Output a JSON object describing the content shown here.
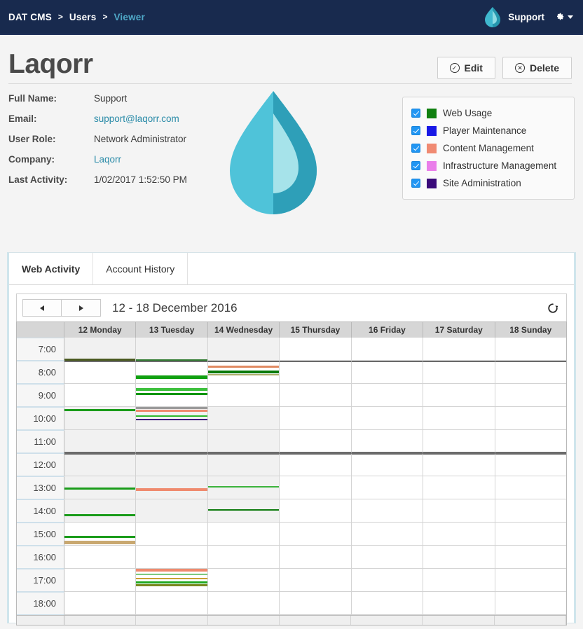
{
  "topnav": {
    "breadcrumb": [
      {
        "label": "DAT CMS",
        "active": false
      },
      {
        "label": "Users",
        "active": false
      },
      {
        "label": "Viewer",
        "active": true
      }
    ],
    "separator": ">",
    "user_label": "Support",
    "gear_icon": "gear-icon",
    "caret_icon": "chevron-down-icon",
    "logo_icon": "droplet-logo-icon",
    "bg_color": "#182a4e",
    "active_crumb_color": "#4fa8c7"
  },
  "profile": {
    "title": "Laqorr",
    "edit_label": "Edit",
    "edit_glyph": "✓",
    "delete_label": "Delete",
    "delete_glyph": "✕",
    "fields": [
      {
        "label": "Full Name:",
        "value": "Support",
        "link": false
      },
      {
        "label": "Email:",
        "value": "support@laqorr.com",
        "link": true
      },
      {
        "label": "User Role:",
        "value": "Network Administrator",
        "link": false
      },
      {
        "label": "Company:",
        "value": "Laqorr",
        "link": true
      },
      {
        "label": "Last Activity:",
        "value": "1/02/2017 1:52:50 PM",
        "link": false
      }
    ]
  },
  "legend": {
    "items": [
      {
        "label": "Web Usage",
        "color": "#108010",
        "checked": true
      },
      {
        "label": "Player Maintenance",
        "color": "#1818e6",
        "checked": true
      },
      {
        "label": "Content Management",
        "color": "#f08a72",
        "checked": true
      },
      {
        "label": "Infrastructure Management",
        "color": "#ea7eea",
        "checked": true
      },
      {
        "label": "Site Administration",
        "color": "#3a0a7a",
        "checked": true
      }
    ]
  },
  "tabs": [
    {
      "label": "Web Activity",
      "active": true
    },
    {
      "label": "Account History",
      "active": false
    }
  ],
  "calendar": {
    "prev_icon": "triangle-left-icon",
    "next_icon": "triangle-right-icon",
    "range_label": "12 - 18 December 2016",
    "refresh_icon": "refresh-icon",
    "gutter_header": "",
    "days": [
      "12 Monday",
      "13 Tuesday",
      "14 Wednesday",
      "15 Thursday",
      "16 Friday",
      "17 Saturday",
      "18 Sunday"
    ],
    "times": [
      "7:00",
      "8:00",
      "9:00",
      "10:00",
      "11:00",
      "12:00",
      "13:00",
      "14:00",
      "15:00",
      "16:00",
      "17:00",
      "18:00"
    ],
    "shaded_rows": [
      0,
      3,
      4,
      5,
      6,
      7
    ],
    "shaded_days": [
      0,
      1,
      2
    ],
    "heavy_line_rows": [
      1,
      5
    ],
    "events": [
      {
        "day": 0,
        "row": 0,
        "offset": 30,
        "color": "#4a5a20",
        "height": 4
      },
      {
        "day": 0,
        "row": 3,
        "offset": 3,
        "color": "#1a9c1a",
        "height": 3
      },
      {
        "day": 0,
        "row": 6,
        "offset": 16,
        "color": "#1a9c1a",
        "height": 3
      },
      {
        "day": 0,
        "row": 7,
        "offset": 21,
        "color": "#1a9c1a",
        "height": 3
      },
      {
        "day": 0,
        "row": 8,
        "offset": 19,
        "color": "#1a9c1a",
        "height": 3
      },
      {
        "day": 0,
        "row": 8,
        "offset": 26,
        "color": "#c9a870",
        "height": 5
      },
      {
        "day": 1,
        "row": 0,
        "offset": 31,
        "color": "#2f7a2f",
        "height": 2
      },
      {
        "day": 1,
        "row": 1,
        "offset": 19,
        "color": "#10a010",
        "height": 5
      },
      {
        "day": 1,
        "row": 2,
        "offset": 6,
        "color": "#3cc03c",
        "height": 4
      },
      {
        "day": 1,
        "row": 2,
        "offset": 13,
        "color": "#0f960f",
        "height": 3
      },
      {
        "day": 1,
        "row": 3,
        "offset": 0,
        "color": "#9a9a9a",
        "height": 3
      },
      {
        "day": 1,
        "row": 3,
        "offset": 4,
        "color": "#ef8a6e",
        "height": 3
      },
      {
        "day": 1,
        "row": 3,
        "offset": 12,
        "color": "#2eb82e",
        "height": 2
      },
      {
        "day": 1,
        "row": 3,
        "offset": 17,
        "color": "#3a0a7a",
        "height": 2
      },
      {
        "day": 1,
        "row": 6,
        "offset": 17,
        "color": "#ef8a6e",
        "height": 4
      },
      {
        "day": 1,
        "row": 10,
        "offset": 0,
        "color": "#ef8a6e",
        "height": 4
      },
      {
        "day": 1,
        "row": 10,
        "offset": 7,
        "color": "#7ec97e",
        "height": 2
      },
      {
        "day": 1,
        "row": 10,
        "offset": 13,
        "color": "#c9a030",
        "height": 2
      },
      {
        "day": 1,
        "row": 10,
        "offset": 18,
        "color": "#1fa81f",
        "height": 3
      },
      {
        "day": 1,
        "row": 10,
        "offset": 22,
        "color": "#7a8a20",
        "height": 3
      },
      {
        "day": 2,
        "row": 1,
        "offset": 5,
        "color": "#e08a62",
        "height": 3
      },
      {
        "day": 2,
        "row": 1,
        "offset": 12,
        "color": "#0a7a0a",
        "height": 4
      },
      {
        "day": 2,
        "row": 1,
        "offset": 17,
        "color": "#b0b070",
        "height": 2
      },
      {
        "day": 2,
        "row": 6,
        "offset": 14,
        "color": "#3cb33c",
        "height": 2
      },
      {
        "day": 2,
        "row": 7,
        "offset": 14,
        "color": "#0d7a0d",
        "height": 2
      }
    ]
  }
}
